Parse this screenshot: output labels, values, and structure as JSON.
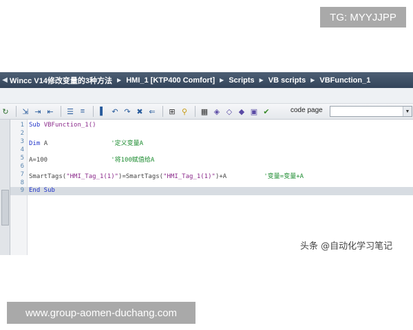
{
  "watermark_top": "TG: MYYJJPP",
  "watermark_bottom": "www.group-aomen-duchang.com",
  "breadcrumb": [
    "Wincc V14修改变量的3种方法",
    "HMI_1 [KTP400 Comfort]",
    "Scripts",
    "VB scripts",
    "VBFunction_1"
  ],
  "toolbar": {
    "code_page_label": "code page",
    "code_page_value": ""
  },
  "code": {
    "lines": [
      {
        "n": "1",
        "parts": [
          {
            "t": "Sub ",
            "c": "kw"
          },
          {
            "t": "VBFunction_1()",
            "c": "str"
          }
        ]
      },
      {
        "n": "2",
        "parts": []
      },
      {
        "n": "3",
        "parts": [
          {
            "t": "Dim ",
            "c": "kw"
          },
          {
            "t": "A",
            "c": "plain"
          },
          {
            "t": "                 '定义变量A",
            "c": "cmt"
          }
        ]
      },
      {
        "n": "4",
        "parts": []
      },
      {
        "n": "5",
        "parts": [
          {
            "t": "A=100",
            "c": "plain"
          },
          {
            "t": "                 '将100赋值给A",
            "c": "cmt"
          }
        ]
      },
      {
        "n": "6",
        "parts": []
      },
      {
        "n": "7",
        "parts": [
          {
            "t": "SmartTags(",
            "c": "plain"
          },
          {
            "t": "\"HMI_Tag_1(1)\"",
            "c": "str"
          },
          {
            "t": ")=SmartTags(",
            "c": "plain"
          },
          {
            "t": "\"HMI_Tag_1(1)\"",
            "c": "str"
          },
          {
            "t": ")+A",
            "c": "plain"
          },
          {
            "t": "          '变量=变量+A",
            "c": "cmt"
          }
        ]
      },
      {
        "n": "8",
        "parts": []
      },
      {
        "n": "9",
        "parts": [
          {
            "t": "End Sub",
            "c": "kw"
          }
        ]
      }
    ]
  },
  "source_credit": "头条 @自动化学习笔记"
}
